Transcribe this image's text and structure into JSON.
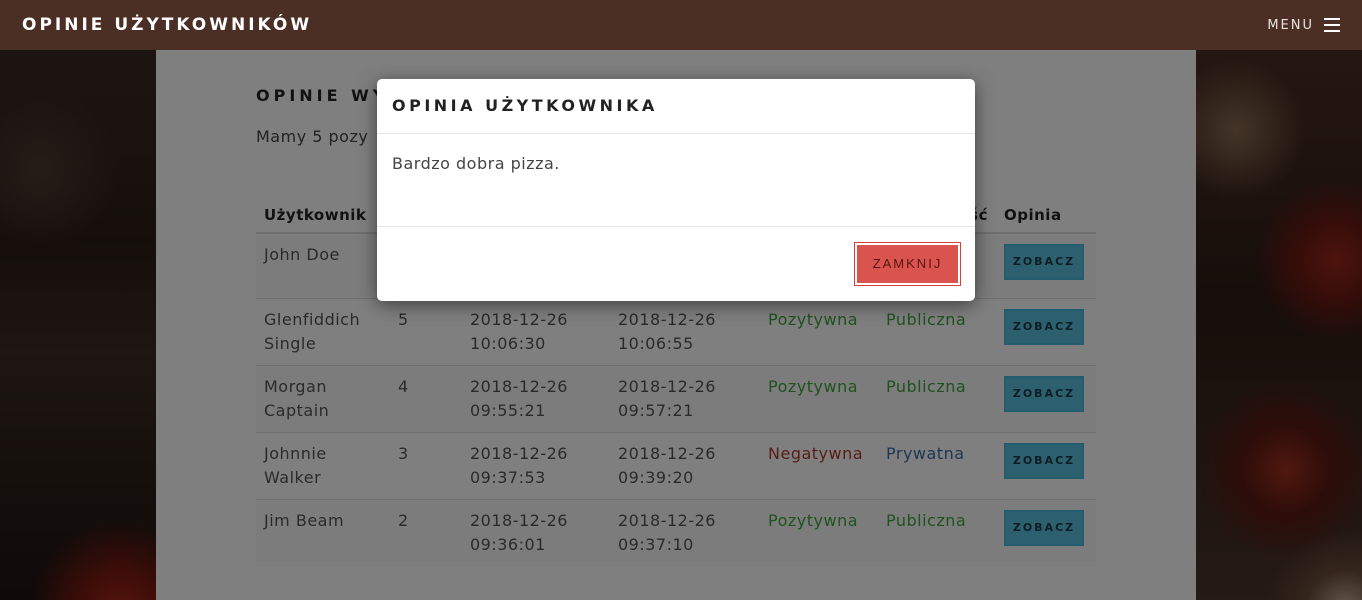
{
  "topbar": {
    "brand": "OPINIE UŻYTKOWNIKÓW",
    "menu_label": "MENU"
  },
  "page": {
    "section_title": "OPINIE WY",
    "lead": "Mamy 5 pozy"
  },
  "table": {
    "headers": [
      "Użytkownik",
      "",
      "",
      "",
      "",
      "ść",
      "Opinia"
    ],
    "rows": [
      {
        "user": "John Doe",
        "rating": "",
        "created": "",
        "updated": "",
        "type": "",
        "visibility": "",
        "button": "ZOBACZ"
      },
      {
        "user": "Glenfiddich Single",
        "rating": "5",
        "created": "2018-12-26 10:06:30",
        "updated": "2018-12-26 10:06:55",
        "type": "Pozytywna",
        "visibility": "Publiczna",
        "button": "ZOBACZ"
      },
      {
        "user": "Morgan Captain",
        "rating": "4",
        "created": "2018-12-26 09:55:21",
        "updated": "2018-12-26 09:57:21",
        "type": "Pozytywna",
        "visibility": "Publiczna",
        "button": "ZOBACZ"
      },
      {
        "user": "Johnnie Walker",
        "rating": "3",
        "created": "2018-12-26 09:37:53",
        "updated": "2018-12-26 09:39:20",
        "type": "Negatywna",
        "visibility": "Prywatna",
        "button": "ZOBACZ"
      },
      {
        "user": "Jim Beam",
        "rating": "2",
        "created": "2018-12-26 09:36:01",
        "updated": "2018-12-26 09:37:10",
        "type": "Pozytywna",
        "visibility": "Publiczna",
        "button": "ZOBACZ"
      }
    ]
  },
  "modal": {
    "title": "OPINIA UŻYTKOWNIKA",
    "body": "Bardzo dobra pizza.",
    "close_label": "ZAMKNIJ"
  },
  "colors": {
    "topbar": "#4b2f25",
    "positive": "#3ca73c",
    "negative": "#b03a2e",
    "private": "#3a6fa5",
    "view_button": "#5bc0de",
    "close_button": "#d9534f"
  }
}
